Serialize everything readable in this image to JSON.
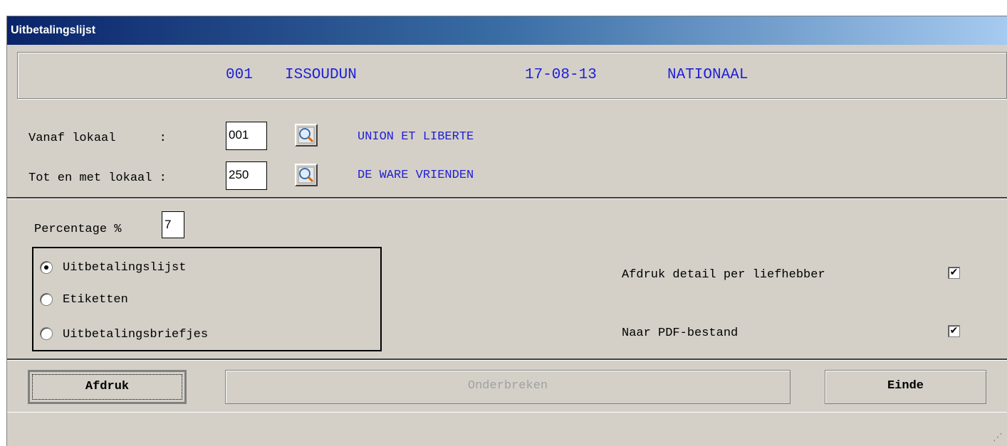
{
  "window": {
    "title": "Uitbetalingslijst"
  },
  "header": {
    "code": "001",
    "location": "ISSOUDUN",
    "date": "17-08-13",
    "type": "NATIONAAL"
  },
  "range": {
    "from_label": "Vanaf lokaal      :",
    "from_value": "001",
    "from_name": "UNION ET LIBERTE",
    "to_label": "Tot en met lokaal :",
    "to_value": "250",
    "to_name": "DE WARE VRIENDEN",
    "lookup_icon": "magnifier-icon"
  },
  "percentage": {
    "label": "Percentage %",
    "value": "7"
  },
  "report_type": {
    "options": [
      "Uitbetalingslijst",
      "Etiketten",
      "Uitbetalingsbriefjes"
    ],
    "selected": "Uitbetalingslijst"
  },
  "options": {
    "detail_label": "Afdruk detail per liefhebber",
    "detail_checked": true,
    "pdf_label": "Naar PDF-bestand",
    "pdf_checked": true,
    "check_glyph": "✔"
  },
  "buttons": {
    "print": "Afdruk",
    "cancel": "Onderbreken",
    "exit": "Einde"
  },
  "colors": {
    "accent_text": "#1f1fd6",
    "title_start": "#0a246a",
    "title_end": "#a6caf0"
  }
}
